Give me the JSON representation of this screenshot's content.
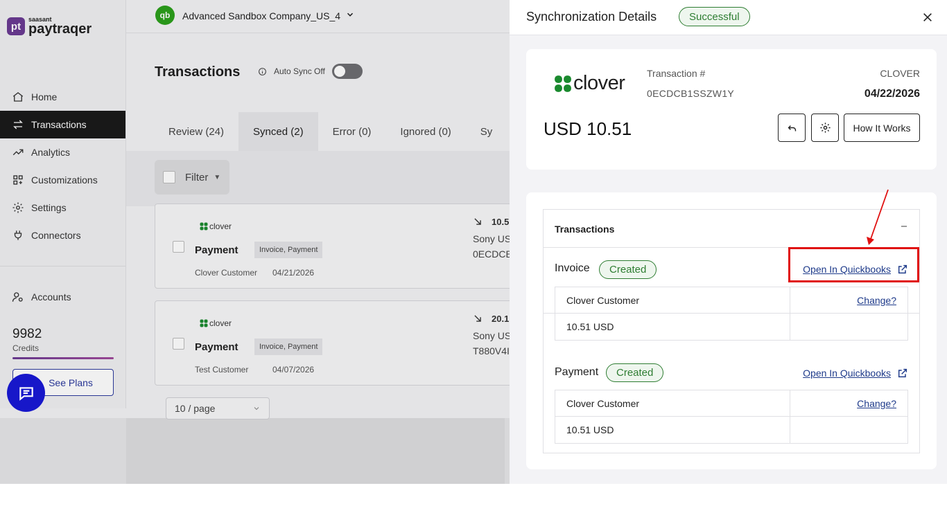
{
  "sidebar": {
    "logo_mark": "pt",
    "logo_small": "saasant",
    "logo_big": "paytraqer",
    "items": [
      {
        "label": "Home",
        "icon": "home-icon"
      },
      {
        "label": "Transactions",
        "icon": "swap-icon",
        "active": true
      },
      {
        "label": "Analytics",
        "icon": "trend-icon"
      },
      {
        "label": "Customizations",
        "icon": "grid-icon"
      },
      {
        "label": "Settings",
        "icon": "gear-icon"
      },
      {
        "label": "Connectors",
        "icon": "plug-icon"
      }
    ],
    "accounts_label": "Accounts",
    "credits_value": "9982",
    "credits_label": "Credits",
    "plans_label": "See Plans"
  },
  "topbar": {
    "qb_mark": "qb",
    "company": "Advanced Sandbox Company_US_4"
  },
  "main": {
    "title": "Transactions",
    "autosync_label": "Auto Sync Off",
    "tabs": [
      "Review (24)",
      "Synced (2)",
      "Error (0)",
      "Ignored (0)",
      "Sy"
    ],
    "filter_label": "Filter",
    "cards": [
      {
        "brand": "clover",
        "type": "Payment",
        "tags": "Invoice, Payment",
        "customer": "Clover Customer",
        "date": "04/21/2026",
        "amount": "10.5",
        "line1": "Sony US",
        "line2": "0ECDCB"
      },
      {
        "brand": "clover",
        "type": "Payment",
        "tags": "Invoice, Payment",
        "customer": "Test Customer",
        "date": "04/07/2026",
        "amount": "20.1",
        "line1": "Sony US",
        "line2": "T880V4I"
      }
    ],
    "pager": "10 / page"
  },
  "drawer": {
    "title": "Synchronization Details",
    "status": "Successful",
    "summary": {
      "brand": "clover",
      "txn_label": "Transaction #",
      "txn_id": "0ECDCB1SSZW1Y",
      "source": "CLOVER",
      "date": "04/22/2026",
      "amount": "USD 10.51",
      "how_label": "How It Works"
    },
    "panel_title": "Transactions",
    "sections": [
      {
        "title": "Invoice",
        "status": "Created",
        "link": "Open In Quickbooks",
        "customer": "Clover Customer",
        "change": "Change?",
        "amount": "10.51 USD"
      },
      {
        "title": "Payment",
        "status": "Created",
        "link": "Open In Quickbooks",
        "customer": "Clover Customer",
        "change": "Change?",
        "amount": "10.51 USD"
      }
    ]
  },
  "colors": {
    "success_green": "#2e7d32",
    "link_blue": "#1e3a8a",
    "annotation_red": "#e01010",
    "brand_purple": "#6b3b93",
    "clover_green": "#1a8a2e",
    "qb_green": "#2ca01c",
    "chat_blue": "#1717c9"
  }
}
